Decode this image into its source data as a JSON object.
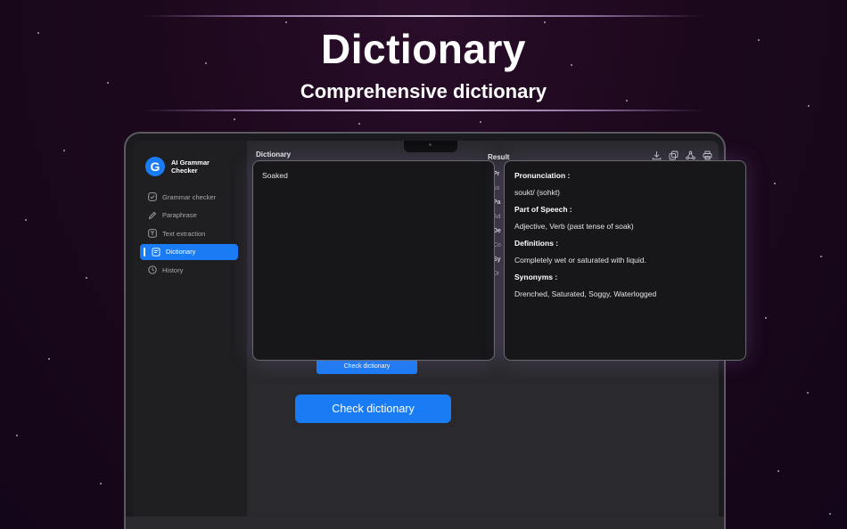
{
  "hero": {
    "title": "Dictionary",
    "subtitle": "Comprehensive dictionary"
  },
  "app": {
    "name": "AI Grammar Checker",
    "logo_letter": "G",
    "accent_color": "#1a7cf5"
  },
  "sidebar": {
    "items": [
      {
        "label": "Grammar checker",
        "icon": "check-square-icon",
        "active": false
      },
      {
        "label": "Paraphrase",
        "icon": "pencil-icon",
        "active": false
      },
      {
        "label": "Text extraction",
        "icon": "text-box-icon",
        "active": false
      },
      {
        "label": "Dictionary",
        "icon": "book-icon",
        "active": true
      },
      {
        "label": "History",
        "icon": "clock-icon",
        "active": false
      }
    ]
  },
  "main": {
    "title": "Dictionary",
    "result_title": "Result",
    "toolbar_icons": [
      "download-icon",
      "copy-icon",
      "share-icon",
      "print-icon"
    ],
    "small_button_label": "Check dictionary",
    "background_result": [
      "Pr",
      "so",
      "Pa",
      "Ad",
      "De",
      "Co",
      "Sy",
      "Dr"
    ]
  },
  "input": {
    "value": "Soaked"
  },
  "result": {
    "pronunciation_label": "Pronunciation :",
    "pronunciation": "soukt/ (sohkt)",
    "pos_label": "Part of Speech :",
    "pos": "Adjective, Verb (past tense of soak)",
    "definitions_label": "Definitions :",
    "definitions": "Completely wet or saturated with liquid.",
    "synonyms_label": "Synonyms :",
    "synonyms": "Drenched, Saturated, Soggy, Waterlogged"
  },
  "cta": {
    "label": "Check dictionary"
  }
}
